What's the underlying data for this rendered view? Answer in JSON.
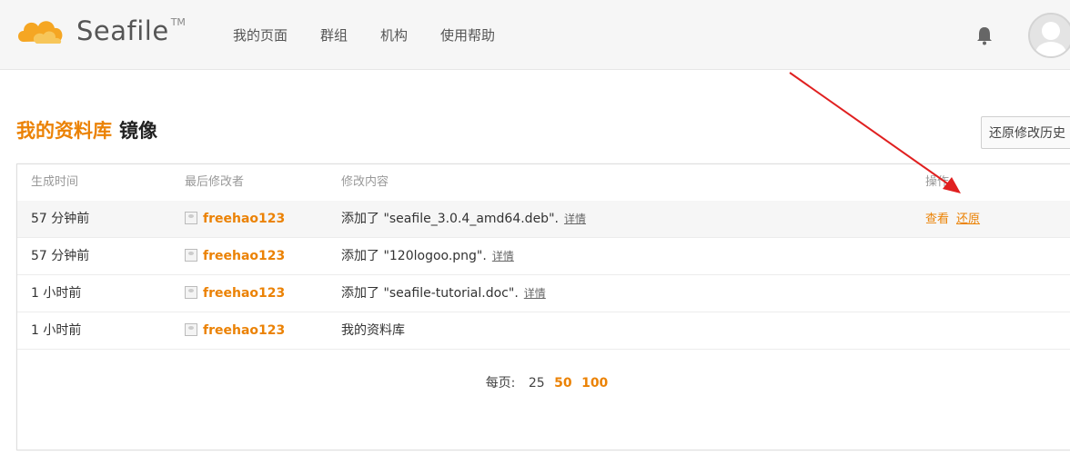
{
  "app": {
    "name": "Seafile",
    "tm": "TM"
  },
  "nav": {
    "items": [
      "我的页面",
      "群组",
      "机构",
      "使用帮助"
    ]
  },
  "page": {
    "title_prefix": "我的资料库",
    "title_name": "镜像",
    "revert_button": "还原修改历史"
  },
  "table": {
    "headers": {
      "time": "生成时间",
      "modifier": "最后修改者",
      "content": "修改内容",
      "ops": "操作"
    },
    "rows": [
      {
        "time": "57 分钟前",
        "user": "freehao123",
        "content": "添加了 \"seafile_3.0.4_amd64.deb\".",
        "detail": "详情",
        "highlighted": true
      },
      {
        "time": "57 分钟前",
        "user": "freehao123",
        "content": "添加了 \"120logoo.png\".",
        "detail": "详情",
        "highlighted": false
      },
      {
        "time": "1 小时前",
        "user": "freehao123",
        "content": "添加了 \"seafile-tutorial.doc\".",
        "detail": "详情",
        "highlighted": false
      },
      {
        "time": "1 小时前",
        "user": "freehao123",
        "content": "我的资料库",
        "detail": "",
        "highlighted": false
      }
    ],
    "row_ops": {
      "view": "查看",
      "restore": "还原"
    }
  },
  "pager": {
    "label": "每页:",
    "options": [
      "25",
      "50",
      "100"
    ],
    "current": "25"
  },
  "colors": {
    "accent": "#eb8205",
    "arrow": "#e02020"
  },
  "icons": {
    "logo": "seafile-cloud-logo",
    "bell": "bell-icon",
    "avatar": "user-avatar",
    "user": "user-icon"
  }
}
